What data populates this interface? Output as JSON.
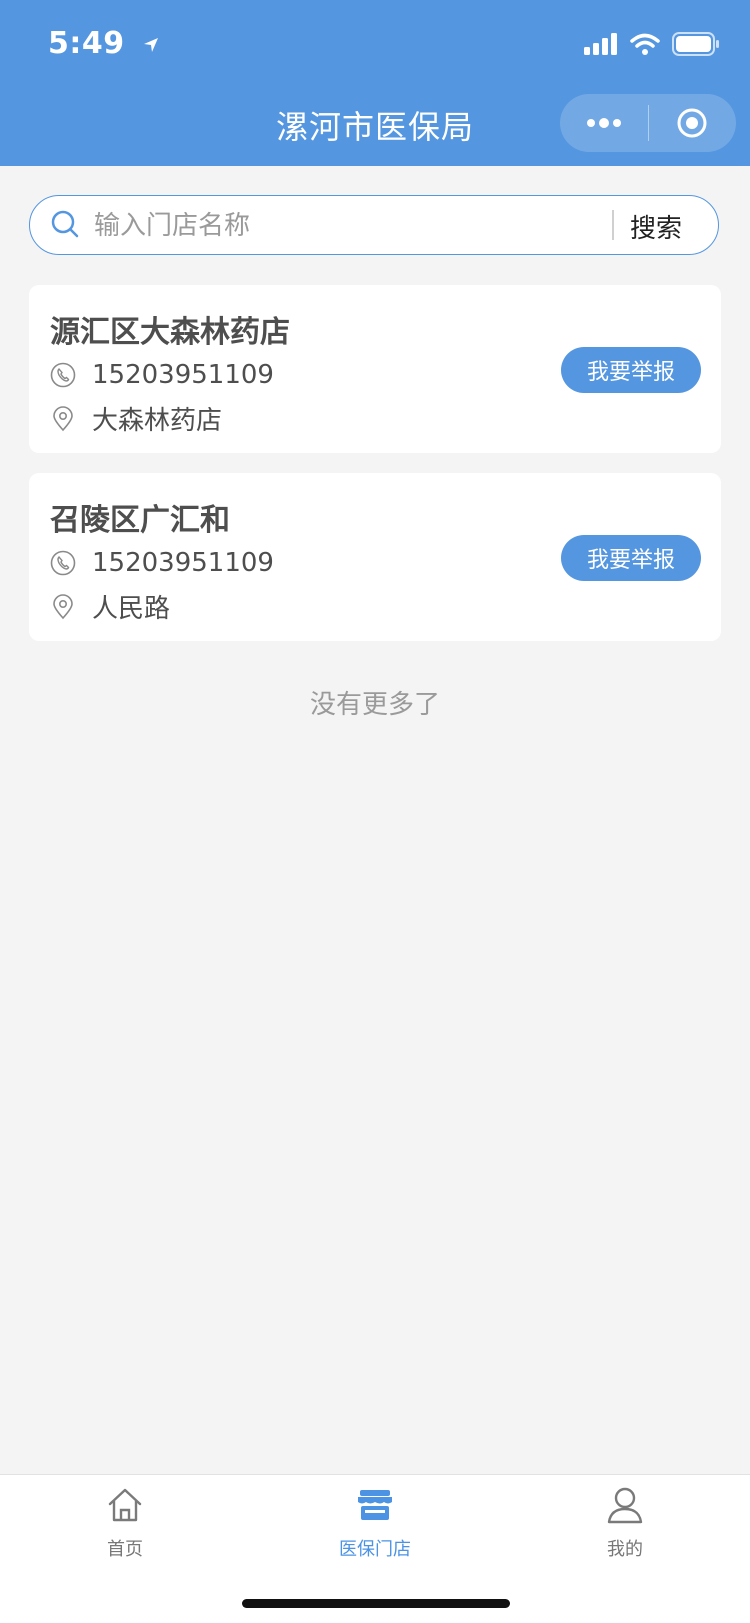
{
  "status_bar": {
    "time": "5:49"
  },
  "header": {
    "title": "漯河市医保局"
  },
  "search": {
    "placeholder": "输入门店名称",
    "value": "",
    "button_label": "搜索"
  },
  "stores": [
    {
      "name": "源汇区大森林药店",
      "phone": "15203951109",
      "address": "大森林药店",
      "report_label": "我要举报"
    },
    {
      "name": "召陵区广汇和",
      "phone": "15203951109",
      "address": "人民路",
      "report_label": "我要举报"
    }
  ],
  "list_end_text": "没有更多了",
  "tabs": [
    {
      "label": "首页",
      "icon": "home-icon",
      "active": false
    },
    {
      "label": "医保门店",
      "icon": "store-icon",
      "active": true
    },
    {
      "label": "我的",
      "icon": "user-icon",
      "active": false
    }
  ],
  "colors": {
    "primary": "#5496e0",
    "background": "#f4f4f4",
    "active_tab": "#4c93e4"
  }
}
